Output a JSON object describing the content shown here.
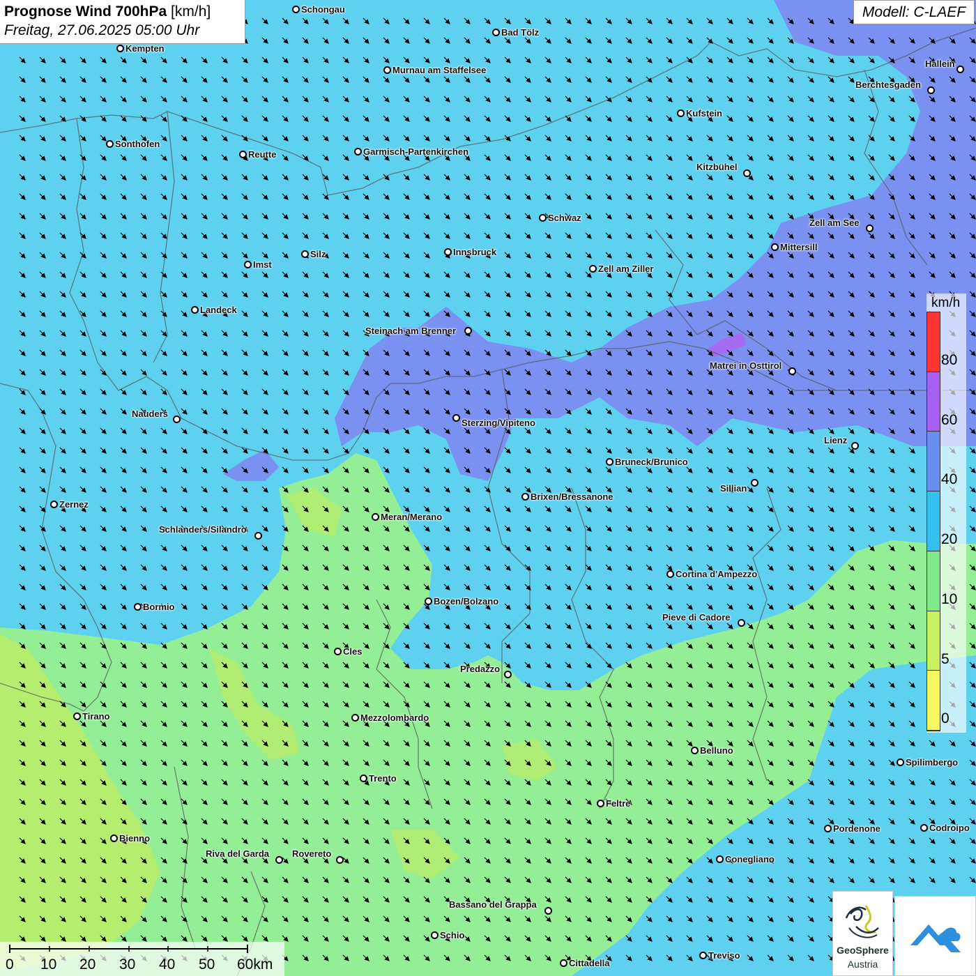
{
  "title": {
    "main": "Prognose Wind 700hPa",
    "unit": "[km/h]",
    "datetime": "Freitag, 27.06.2025 05:00 Uhr"
  },
  "model": "Modell: C-LAEF",
  "legend": {
    "unit": "km/h",
    "ticks": [
      "80",
      "60",
      "40",
      "20",
      "10",
      "5",
      "0"
    ],
    "colors": [
      "#ff3535",
      "#a860f0",
      "#6a8ef0",
      "#35c0f0",
      "#7ee88a",
      "#c8f060",
      "#f8f860"
    ]
  },
  "scale": {
    "labels": [
      "0",
      "10",
      "20",
      "30",
      "40",
      "50",
      "60km"
    ]
  },
  "logos": {
    "geosphere_line1": "GeoSphere",
    "geosphere_line2": "Austria",
    "geosphere_icon": "geosphere-logo",
    "second_icon": "austria-logo"
  },
  "wind": {
    "direction": "north-west to south-east",
    "field_colors": {
      "calm": "#a8e872",
      "light": "#94ee96",
      "moderate": "#5ed0f0",
      "strong": "#7d8af2",
      "very_strong": "#a86af0"
    }
  },
  "cities": [
    {
      "name": "Schongau"
    },
    {
      "name": "Bad Tölz"
    },
    {
      "name": "Kempten"
    },
    {
      "name": "Murnau am Staffelsee"
    },
    {
      "name": "Hallein"
    },
    {
      "name": "Berchtesgaden"
    },
    {
      "name": "Kufstein"
    },
    {
      "name": "Sonthofen"
    },
    {
      "name": "Reutte"
    },
    {
      "name": "Garmisch-Partenkirchen"
    },
    {
      "name": "Kitzbühel"
    },
    {
      "name": "Schwaz"
    },
    {
      "name": "Zell am See"
    },
    {
      "name": "Mittersill"
    },
    {
      "name": "Silz"
    },
    {
      "name": "Innsbruck"
    },
    {
      "name": "Imst"
    },
    {
      "name": "Zell am Ziller"
    },
    {
      "name": "Landeck"
    },
    {
      "name": "Steinach am Brenner"
    },
    {
      "name": "Matrei in Osttirol"
    },
    {
      "name": "Nauders"
    },
    {
      "name": "Sterzing/Vipiteno"
    },
    {
      "name": "Lienz"
    },
    {
      "name": "Bruneck/Brunico"
    },
    {
      "name": "Sillian"
    },
    {
      "name": "Zernez"
    },
    {
      "name": "Brixen/Bressanone"
    },
    {
      "name": "Meran/Merano"
    },
    {
      "name": "Schlanders/Silandro"
    },
    {
      "name": "Cortina d'Ampezzo"
    },
    {
      "name": "Bormio"
    },
    {
      "name": "Bozen/Bolzano"
    },
    {
      "name": "Pieve di Cadore"
    },
    {
      "name": "Cles"
    },
    {
      "name": "Predazzo"
    },
    {
      "name": "Tirano"
    },
    {
      "name": "Mezzolombardo"
    },
    {
      "name": "Belluno"
    },
    {
      "name": "Spilimbergo"
    },
    {
      "name": "Trento"
    },
    {
      "name": "Feltre"
    },
    {
      "name": "Pordenone"
    },
    {
      "name": "Codroipo"
    },
    {
      "name": "Bienno"
    },
    {
      "name": "Riva del Garda"
    },
    {
      "name": "Rovereto"
    },
    {
      "name": "Conegliano"
    },
    {
      "name": "Bassano del Grappa"
    },
    {
      "name": "Schio"
    },
    {
      "name": "Treviso"
    },
    {
      "name": "Cittadella"
    }
  ]
}
